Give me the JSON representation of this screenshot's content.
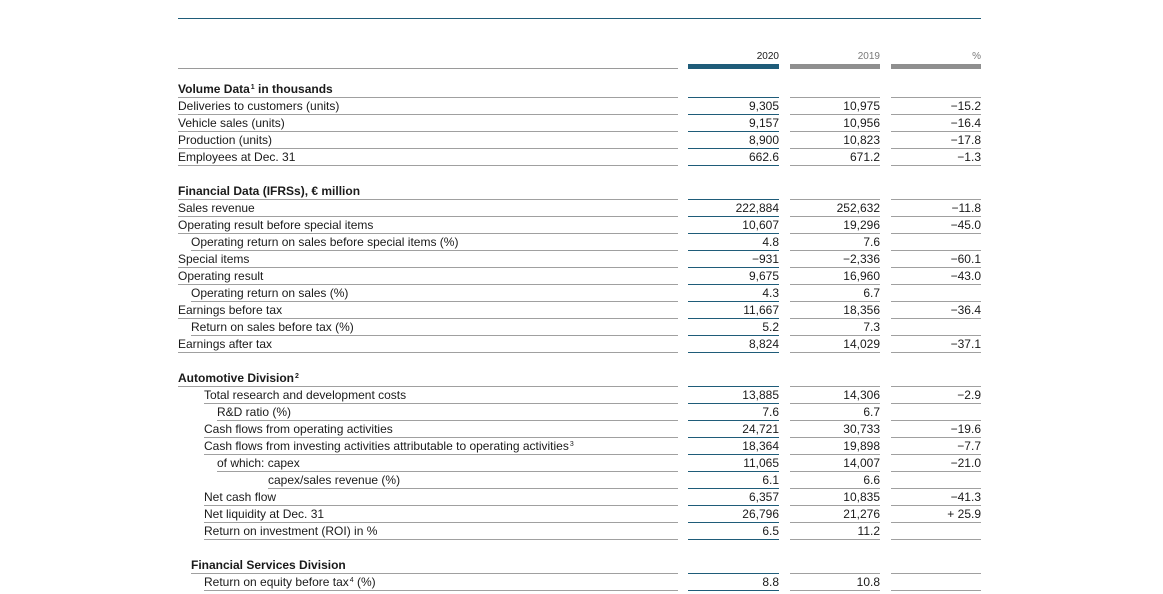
{
  "columns": {
    "y2020": "2020",
    "y2019": "2019",
    "pct": "%"
  },
  "rows": [
    {
      "label": "Volume Data",
      "sup": "1",
      "suffix": " in thousands",
      "section": true,
      "indent": 0,
      "v2020": "",
      "v2019": "",
      "pct": ""
    },
    {
      "label": "Deliveries to customers (units)",
      "indent": 0,
      "v2020": "9,305",
      "v2019": "10,975",
      "pct": "−15.2"
    },
    {
      "label": "Vehicle sales (units)",
      "indent": 0,
      "v2020": "9,157",
      "v2019": "10,956",
      "pct": "−16.4"
    },
    {
      "label": "Production (units)",
      "indent": 0,
      "v2020": "8,900",
      "v2019": "10,823",
      "pct": "−17.8"
    },
    {
      "label": "Employees at Dec. 31",
      "indent": 0,
      "v2020": "662.6",
      "v2019": "671.2",
      "pct": "−1.3"
    },
    {
      "label": "Financial Data (IFRSs), € million",
      "section": true,
      "indent": 0,
      "v2020": "",
      "v2019": "",
      "pct": ""
    },
    {
      "label": "Sales revenue",
      "indent": 0,
      "v2020": "222,884",
      "v2019": "252,632",
      "pct": "−11.8"
    },
    {
      "label": "Operating result before special items",
      "indent": 0,
      "v2020": "10,607",
      "v2019": "19,296",
      "pct": "−45.0"
    },
    {
      "label": "Operating return on sales before special items (%)",
      "indent": 1,
      "v2020": "4.8",
      "v2019": "7.6",
      "pct": ""
    },
    {
      "label": "Special items",
      "indent": 0,
      "v2020": "−931",
      "v2019": "−2,336",
      "pct": "−60.1"
    },
    {
      "label": "Operating result",
      "indent": 0,
      "v2020": "9,675",
      "v2019": "16,960",
      "pct": "−43.0"
    },
    {
      "label": "Operating return on sales (%)",
      "indent": 1,
      "v2020": "4.3",
      "v2019": "6.7",
      "pct": ""
    },
    {
      "label": "Earnings before tax",
      "indent": 0,
      "v2020": "11,667",
      "v2019": "18,356",
      "pct": "−36.4"
    },
    {
      "label": "Return on sales before tax (%)",
      "indent": 1,
      "v2020": "5.2",
      "v2019": "7.3",
      "pct": ""
    },
    {
      "label": "Earnings after tax",
      "indent": 0,
      "v2020": "8,824",
      "v2019": "14,029",
      "pct": "−37.1"
    },
    {
      "label": "Automotive Division",
      "sup": "2",
      "section": true,
      "indent": 0,
      "v2020": "",
      "v2019": "",
      "pct": ""
    },
    {
      "label": "Total research and development costs",
      "indent": 2,
      "v2020": "13,885",
      "v2019": "14,306",
      "pct": "−2.9"
    },
    {
      "label": "R&D ratio (%)",
      "indent": 3,
      "v2020": "7.6",
      "v2019": "6.7",
      "pct": ""
    },
    {
      "label": "Cash flows from operating activities",
      "indent": 2,
      "v2020": "24,721",
      "v2019": "30,733",
      "pct": "−19.6"
    },
    {
      "label": "Cash flows from investing activities attributable to operating activities",
      "sup": "3",
      "indent": 2,
      "v2020": "18,364",
      "v2019": "19,898",
      "pct": "−7.7"
    },
    {
      "label": "of which: capex",
      "indent": 3,
      "v2020": "11,065",
      "v2019": "14,007",
      "pct": "−21.0"
    },
    {
      "label": "capex/sales revenue (%)",
      "indent": 4,
      "v2020": "6.1",
      "v2019": "6.6",
      "pct": ""
    },
    {
      "label": "Net cash flow",
      "indent": 2,
      "v2020": "6,357",
      "v2019": "10,835",
      "pct": "−41.3"
    },
    {
      "label": "Net liquidity at Dec. 31",
      "indent": 2,
      "v2020": "26,796",
      "v2019": "21,276",
      "pct": "+ 25.9"
    },
    {
      "label": "Return on investment (ROI) in %",
      "indent": 2,
      "v2020": "6.5",
      "v2019": "11.2",
      "pct": ""
    },
    {
      "label": "Financial Services Division",
      "section": true,
      "indent": 1,
      "v2020": "",
      "v2019": "",
      "pct": ""
    },
    {
      "label": "Return on equity before tax",
      "sup": "4",
      "suffix": " (%)",
      "indent": 2,
      "v2020": "8.8",
      "v2019": "10.8",
      "pct": ""
    }
  ]
}
